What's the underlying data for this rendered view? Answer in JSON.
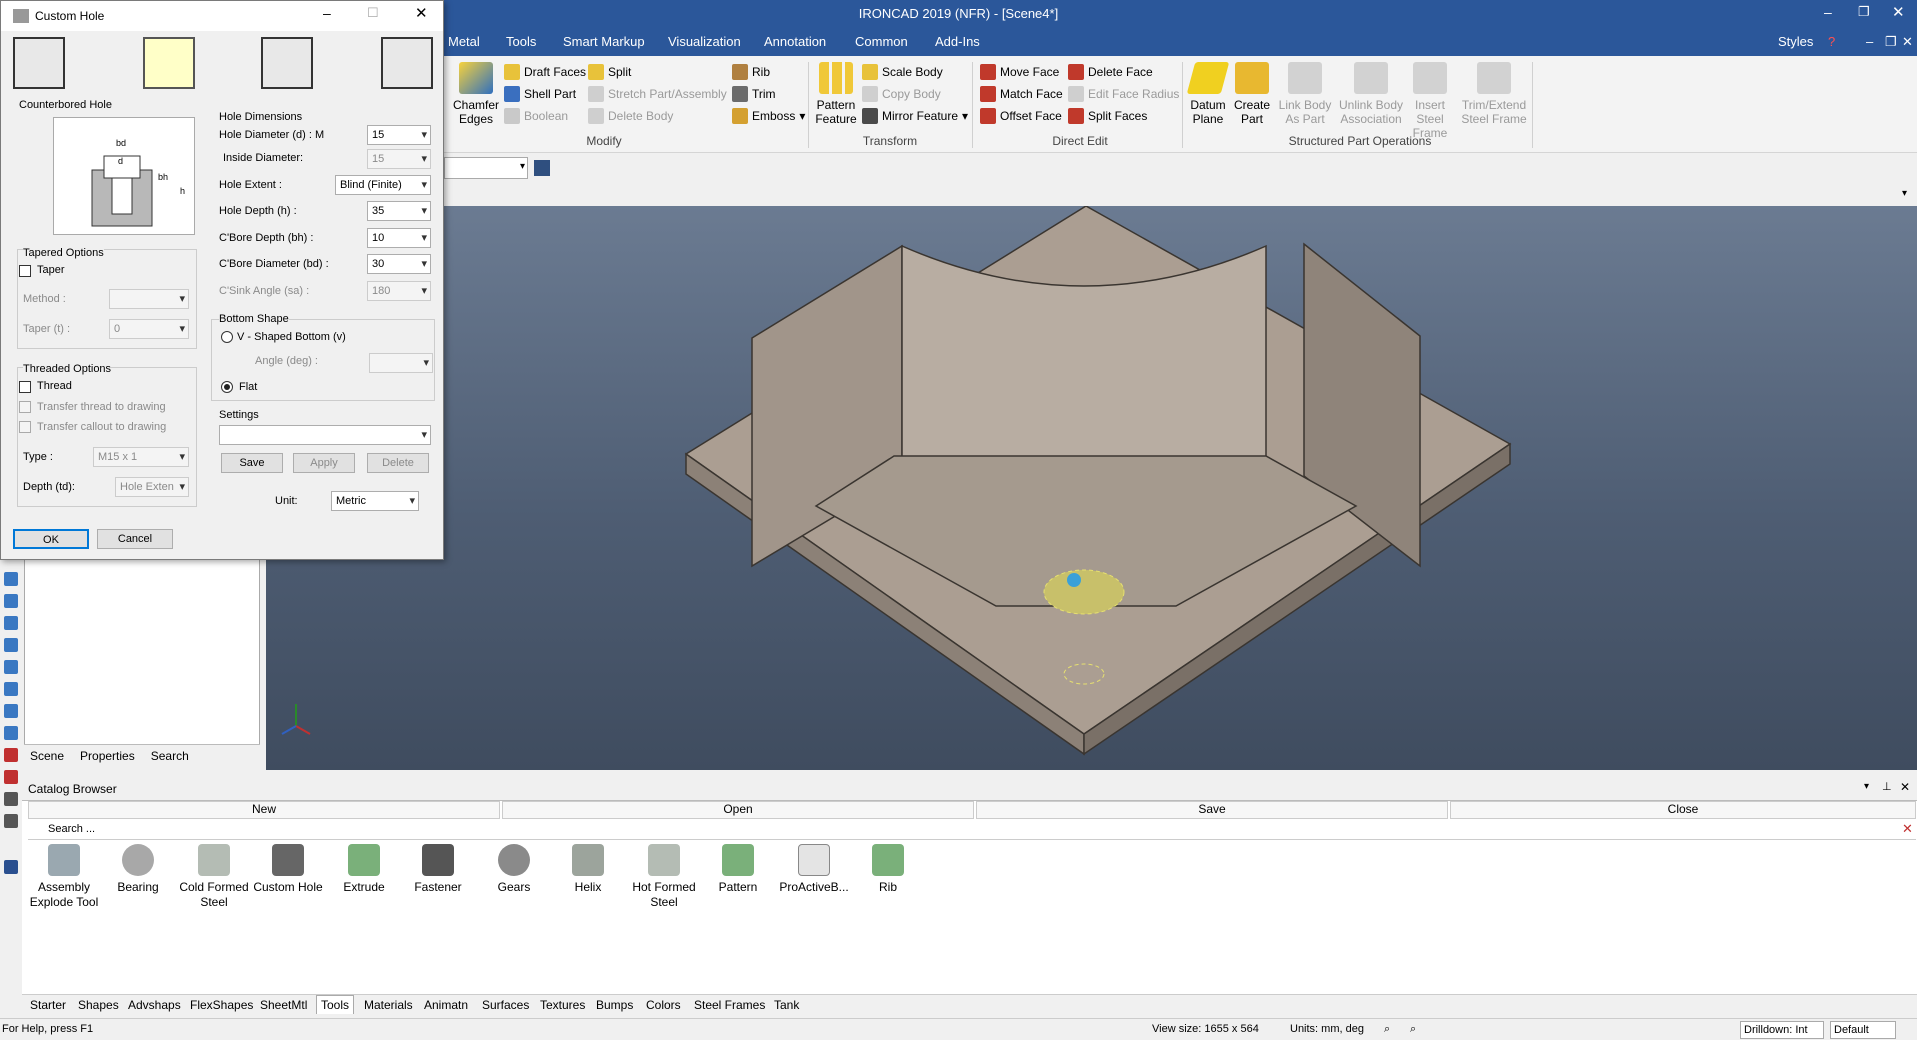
{
  "window": {
    "title": "IRONCAD 2019 (NFR) - [Scene4*]",
    "styles_label": "Styles"
  },
  "menu": {
    "items": [
      "Metal",
      "Tools",
      "Smart Markup",
      "Visualization",
      "Annotation",
      "Common",
      "Add-Ins"
    ]
  },
  "ribbon": {
    "chamfer_edges": "Chamfer Edges",
    "draft_faces": "Draft Faces",
    "split": "Split",
    "shell_part": "Shell Part",
    "stretch_part": "Stretch Part/Assembly",
    "boolean": "Boolean",
    "delete_body": "Delete Body",
    "rib": "Rib",
    "trim": "Trim",
    "emboss": "Emboss",
    "modify_group": "Modify",
    "pattern_feature": "Pattern Feature",
    "scale_body": "Scale Body",
    "copy_body": "Copy Body",
    "mirror_feature": "Mirror Feature",
    "transform_group": "Transform",
    "move_face": "Move Face",
    "delete_face": "Delete Face",
    "match_face": "Match Face",
    "edit_face_radius": "Edit Face Radius",
    "offset_face": "Offset Face",
    "split_faces": "Split Faces",
    "direct_edit_group": "Direct Edit",
    "datum_plane": "Datum Plane",
    "create_part": "Create Part",
    "link_body": "Link Body As Part",
    "unlink_body": "Unlink Body Association",
    "insert_steel": "Insert Steel Frame",
    "trim_extend": "Trim/Extend Steel Frame",
    "structured_group": "Structured Part Operations"
  },
  "dialog": {
    "title": "Custom Hole",
    "hole_name": "Counterbored Hole",
    "dims_title": "Hole Dimensions",
    "hole_diameter_label": "Hole Diameter (d) : M",
    "hole_diameter_value": "15",
    "inside_diameter_label": "Inside Diameter:",
    "inside_diameter_value": "15",
    "hole_extent_label": "Hole Extent :",
    "hole_extent_value": "Blind (Finite)",
    "hole_depth_label": "Hole Depth (h) :",
    "hole_depth_value": "35",
    "cbore_depth_label": "C'Bore Depth (bh) :",
    "cbore_depth_value": "10",
    "cbore_diameter_label": "C'Bore Diameter (bd) :",
    "cbore_diameter_value": "30",
    "csink_angle_label": "C'Sink Angle (sa) :",
    "csink_angle_value": "180",
    "tapered_title": "Tapered Options",
    "taper_label": "Taper",
    "method_label": "Method :",
    "taper_t_label": "Taper (t) :",
    "taper_t_value": "0",
    "bottom_title": "Bottom Shape",
    "vshaped_label": "V - Shaped Bottom (v)",
    "angle_label": "Angle (deg) :",
    "flat_label": "Flat",
    "threaded_title": "Threaded Options",
    "thread_label": "Thread",
    "transfer_thread_label": "Transfer thread to drawing",
    "transfer_callout_label": "Transfer callout to drawing",
    "type_label": "Type :",
    "type_value": "M15 x 1",
    "depth_td_label": "Depth (td):",
    "depth_td_value": "Hole Exten",
    "settings_title": "Settings",
    "save_label": "Save",
    "apply_label": "Apply",
    "delete_label": "Delete",
    "unit_label": "Unit:",
    "unit_value": "Metric",
    "ok_label": "OK",
    "cancel_label": "Cancel",
    "diagram_labels": {
      "bd": "bd",
      "d": "d",
      "bh": "bh",
      "h": "h"
    }
  },
  "panel_tabs": [
    "Scene",
    "Properties",
    "Search"
  ],
  "catalog": {
    "title": "Catalog Browser",
    "columns": [
      "New",
      "Open",
      "Save",
      "Close"
    ],
    "search_placeholder": "Search ...",
    "items": [
      "Assembly Explode Tool",
      "Bearing",
      "Cold Formed Steel",
      "Custom Hole",
      "Extrude",
      "Fastener",
      "Gears",
      "Helix",
      "Hot Formed Steel",
      "Pattern",
      "ProActiveB...",
      "Rib"
    ]
  },
  "bottom_tabs": [
    "Starter",
    "Shapes",
    "Advshaps",
    "FlexShapes",
    "SheetMtl",
    "Tools",
    "Materials",
    "Animatn",
    "Surfaces",
    "Textures",
    "Bumps",
    "Colors",
    "Steel Frames",
    "Tank"
  ],
  "status": {
    "help": "For Help, press F1",
    "view_size": "View size: 1655 x 564",
    "units": "Units: mm, deg",
    "drilldown": "Drilldown: Int",
    "default": "Default"
  },
  "colors": {
    "title_bar": "#2b579a",
    "viewport": "#5a6a80",
    "part": "#ab9e92"
  }
}
